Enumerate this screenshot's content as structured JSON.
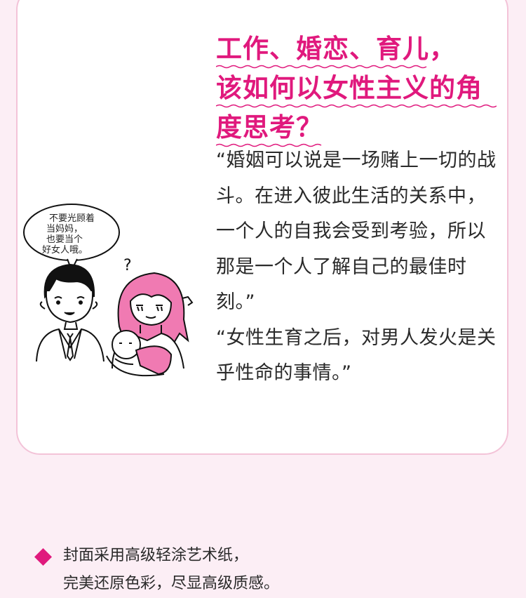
{
  "heading": {
    "lines": [
      "工作、婚恋、育儿，",
      "该如何以女性主义的角",
      "度思考？"
    ]
  },
  "quotes": [
    "“婚姻可以说是一场赌上一切的战斗。在进入彼此生活的关系中，一个人的自我会受到考验，所以那是一个人了解自己的最佳时刻。”",
    "“女性生育之后，对男人发火是关乎性命的事情。”"
  ],
  "illustration": {
    "speech_bubble_lines": [
      "不要光顾着",
      "当妈妈，",
      "也要当个",
      "好女人哦。"
    ],
    "question_mark": "?"
  },
  "feature": {
    "bullet_icon": "diamond-icon",
    "lines": [
      "封面采用高级轻涂艺术纸，",
      "完美还原色彩，尽显高级质感。"
    ]
  },
  "colors": {
    "accent": "#e0197d",
    "background": "#fceef5",
    "card_border": "#f3c3d8",
    "hair_pink": "#f07ab2"
  }
}
